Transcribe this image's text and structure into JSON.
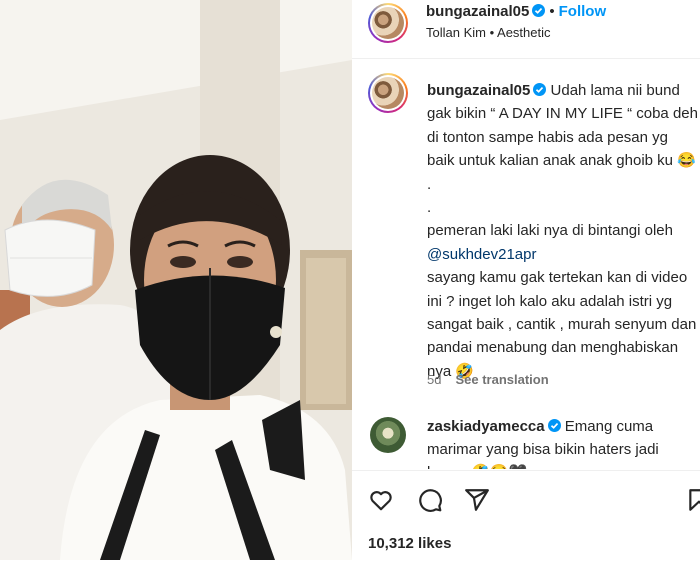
{
  "post": {
    "username": "bungazainal05",
    "follow_label": "Follow",
    "dot": "•",
    "audio": "Tollan Kim • Aesthetic"
  },
  "caption": {
    "username": "bungazainal05",
    "line1": "Udah lama nii bund gak bikin “ A DAY IN MY LIFE “ coba deh di tonton sampe habis ada pesan yg baik untuk kalian anak anak ghoib ku",
    "emoji1": "😂",
    "dot1": ".",
    "dot2": ".",
    "line2": "pemeran laki laki nya di bintangi oleh",
    "mention": "@sukhdev21apr",
    "line3": "sayang kamu gak tertekan kan di video ini ? inget loh kalo aku adalah istri yg sangat baik , cantik , murah senyum dan pandai menabung dan menghabiskan nya",
    "emoji2": "🤣",
    "age": "5d",
    "see_translation": "See translation"
  },
  "comment": {
    "username": "zaskiadyamecca",
    "text": "Emang cuma marimar yang bisa bikin haters jadi lovers",
    "emoji": "🤣😂🖤"
  },
  "actions": {
    "icons": [
      "heart-icon",
      "comment-icon",
      "share-icon",
      "save-icon"
    ],
    "likes": "10,312 likes"
  },
  "colors": {
    "link_blue": "#0095f6",
    "mention_blue": "#00376b",
    "muted": "#737373",
    "text": "#262626"
  }
}
